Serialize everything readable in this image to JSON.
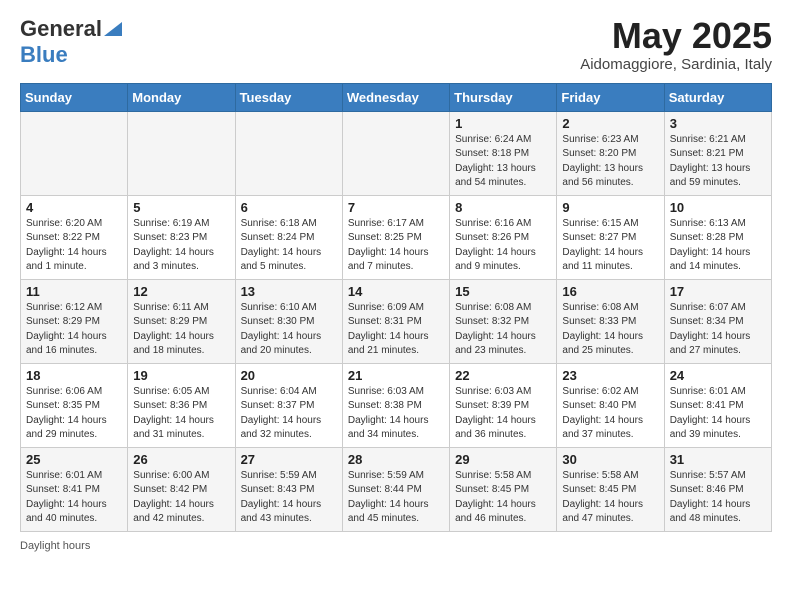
{
  "logo": {
    "general": "General",
    "blue": "Blue"
  },
  "header": {
    "month": "May 2025",
    "location": "Aidomaggiore, Sardinia, Italy"
  },
  "days_of_week": [
    "Sunday",
    "Monday",
    "Tuesday",
    "Wednesday",
    "Thursday",
    "Friday",
    "Saturday"
  ],
  "weeks": [
    [
      {
        "num": "",
        "info": ""
      },
      {
        "num": "",
        "info": ""
      },
      {
        "num": "",
        "info": ""
      },
      {
        "num": "",
        "info": ""
      },
      {
        "num": "1",
        "info": "Sunrise: 6:24 AM\nSunset: 8:18 PM\nDaylight: 13 hours\nand 54 minutes."
      },
      {
        "num": "2",
        "info": "Sunrise: 6:23 AM\nSunset: 8:20 PM\nDaylight: 13 hours\nand 56 minutes."
      },
      {
        "num": "3",
        "info": "Sunrise: 6:21 AM\nSunset: 8:21 PM\nDaylight: 13 hours\nand 59 minutes."
      }
    ],
    [
      {
        "num": "4",
        "info": "Sunrise: 6:20 AM\nSunset: 8:22 PM\nDaylight: 14 hours\nand 1 minute."
      },
      {
        "num": "5",
        "info": "Sunrise: 6:19 AM\nSunset: 8:23 PM\nDaylight: 14 hours\nand 3 minutes."
      },
      {
        "num": "6",
        "info": "Sunrise: 6:18 AM\nSunset: 8:24 PM\nDaylight: 14 hours\nand 5 minutes."
      },
      {
        "num": "7",
        "info": "Sunrise: 6:17 AM\nSunset: 8:25 PM\nDaylight: 14 hours\nand 7 minutes."
      },
      {
        "num": "8",
        "info": "Sunrise: 6:16 AM\nSunset: 8:26 PM\nDaylight: 14 hours\nand 9 minutes."
      },
      {
        "num": "9",
        "info": "Sunrise: 6:15 AM\nSunset: 8:27 PM\nDaylight: 14 hours\nand 11 minutes."
      },
      {
        "num": "10",
        "info": "Sunrise: 6:13 AM\nSunset: 8:28 PM\nDaylight: 14 hours\nand 14 minutes."
      }
    ],
    [
      {
        "num": "11",
        "info": "Sunrise: 6:12 AM\nSunset: 8:29 PM\nDaylight: 14 hours\nand 16 minutes."
      },
      {
        "num": "12",
        "info": "Sunrise: 6:11 AM\nSunset: 8:29 PM\nDaylight: 14 hours\nand 18 minutes."
      },
      {
        "num": "13",
        "info": "Sunrise: 6:10 AM\nSunset: 8:30 PM\nDaylight: 14 hours\nand 20 minutes."
      },
      {
        "num": "14",
        "info": "Sunrise: 6:09 AM\nSunset: 8:31 PM\nDaylight: 14 hours\nand 21 minutes."
      },
      {
        "num": "15",
        "info": "Sunrise: 6:08 AM\nSunset: 8:32 PM\nDaylight: 14 hours\nand 23 minutes."
      },
      {
        "num": "16",
        "info": "Sunrise: 6:08 AM\nSunset: 8:33 PM\nDaylight: 14 hours\nand 25 minutes."
      },
      {
        "num": "17",
        "info": "Sunrise: 6:07 AM\nSunset: 8:34 PM\nDaylight: 14 hours\nand 27 minutes."
      }
    ],
    [
      {
        "num": "18",
        "info": "Sunrise: 6:06 AM\nSunset: 8:35 PM\nDaylight: 14 hours\nand 29 minutes."
      },
      {
        "num": "19",
        "info": "Sunrise: 6:05 AM\nSunset: 8:36 PM\nDaylight: 14 hours\nand 31 minutes."
      },
      {
        "num": "20",
        "info": "Sunrise: 6:04 AM\nSunset: 8:37 PM\nDaylight: 14 hours\nand 32 minutes."
      },
      {
        "num": "21",
        "info": "Sunrise: 6:03 AM\nSunset: 8:38 PM\nDaylight: 14 hours\nand 34 minutes."
      },
      {
        "num": "22",
        "info": "Sunrise: 6:03 AM\nSunset: 8:39 PM\nDaylight: 14 hours\nand 36 minutes."
      },
      {
        "num": "23",
        "info": "Sunrise: 6:02 AM\nSunset: 8:40 PM\nDaylight: 14 hours\nand 37 minutes."
      },
      {
        "num": "24",
        "info": "Sunrise: 6:01 AM\nSunset: 8:41 PM\nDaylight: 14 hours\nand 39 minutes."
      }
    ],
    [
      {
        "num": "25",
        "info": "Sunrise: 6:01 AM\nSunset: 8:41 PM\nDaylight: 14 hours\nand 40 minutes."
      },
      {
        "num": "26",
        "info": "Sunrise: 6:00 AM\nSunset: 8:42 PM\nDaylight: 14 hours\nand 42 minutes."
      },
      {
        "num": "27",
        "info": "Sunrise: 5:59 AM\nSunset: 8:43 PM\nDaylight: 14 hours\nand 43 minutes."
      },
      {
        "num": "28",
        "info": "Sunrise: 5:59 AM\nSunset: 8:44 PM\nDaylight: 14 hours\nand 45 minutes."
      },
      {
        "num": "29",
        "info": "Sunrise: 5:58 AM\nSunset: 8:45 PM\nDaylight: 14 hours\nand 46 minutes."
      },
      {
        "num": "30",
        "info": "Sunrise: 5:58 AM\nSunset: 8:45 PM\nDaylight: 14 hours\nand 47 minutes."
      },
      {
        "num": "31",
        "info": "Sunrise: 5:57 AM\nSunset: 8:46 PM\nDaylight: 14 hours\nand 48 minutes."
      }
    ]
  ],
  "footer": {
    "daylight_label": "Daylight hours"
  }
}
